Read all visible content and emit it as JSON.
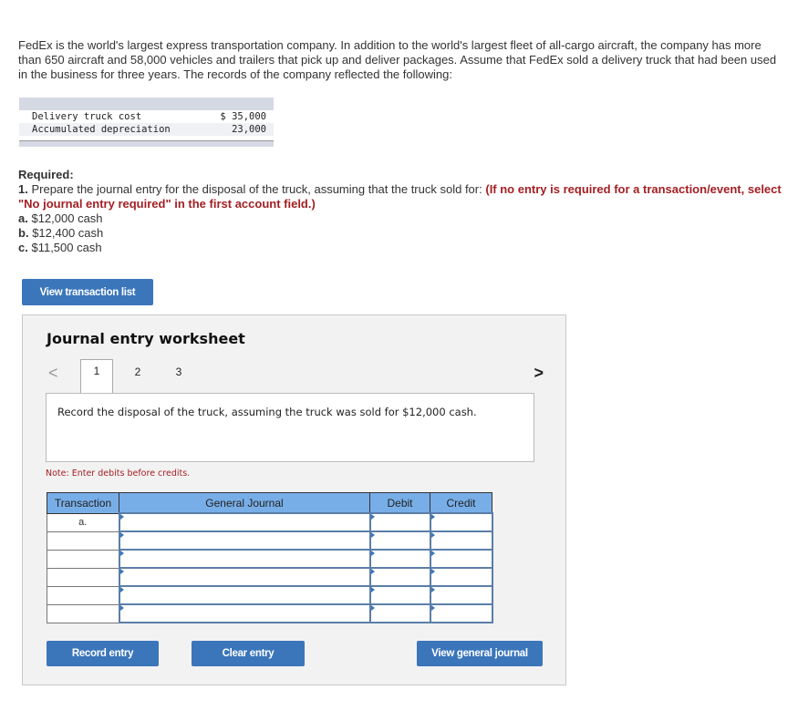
{
  "intro": "FedEx is the world's largest express transportation company. In addition to the world's largest fleet of all-cargo aircraft, the company has more than 650 aircraft and 58,000 vehicles and trailers that pick up and deliver packages. Assume that FedEx sold a delivery truck that had been used in the business for three years. The records of the company reflected the following:",
  "records": [
    {
      "label": "Delivery truck cost",
      "value": "$ 35,000"
    },
    {
      "label": "Accumulated depreciation",
      "value": "23,000"
    }
  ],
  "required": {
    "heading": "Required:",
    "item_num": "1.",
    "item_text": "Prepare the journal entry for the disposal of the truck, assuming that the truck sold for:",
    "instruction": "(If no entry is required for a transaction/event, select \"No journal entry required\" in the first account field.)",
    "options": [
      {
        "letter": "a.",
        "text": "$12,000 cash"
      },
      {
        "letter": "b.",
        "text": "$12,400 cash"
      },
      {
        "letter": "c.",
        "text": "$11,500 cash"
      }
    ]
  },
  "view_transaction_list": "View transaction list",
  "worksheet": {
    "title": "Journal entry worksheet",
    "tabs": [
      "1",
      "2",
      "3"
    ],
    "active_tab": "1",
    "prev": "<",
    "next": ">",
    "instruction": "Record the disposal of the truck, assuming the truck was sold for $12,000 cash.",
    "note": "Note: Enter debits before credits.",
    "columns": [
      "Transaction",
      "General Journal",
      "Debit",
      "Credit"
    ],
    "rows": [
      {
        "transaction": "a.",
        "account": "",
        "debit": "",
        "credit": ""
      },
      {
        "transaction": "",
        "account": "",
        "debit": "",
        "credit": ""
      },
      {
        "transaction": "",
        "account": "",
        "debit": "",
        "credit": ""
      },
      {
        "transaction": "",
        "account": "",
        "debit": "",
        "credit": ""
      },
      {
        "transaction": "",
        "account": "",
        "debit": "",
        "credit": ""
      },
      {
        "transaction": "",
        "account": "",
        "debit": "",
        "credit": ""
      }
    ],
    "record_entry": "Record entry",
    "clear_entry": "Clear entry",
    "view_general_journal": "View general journal"
  }
}
